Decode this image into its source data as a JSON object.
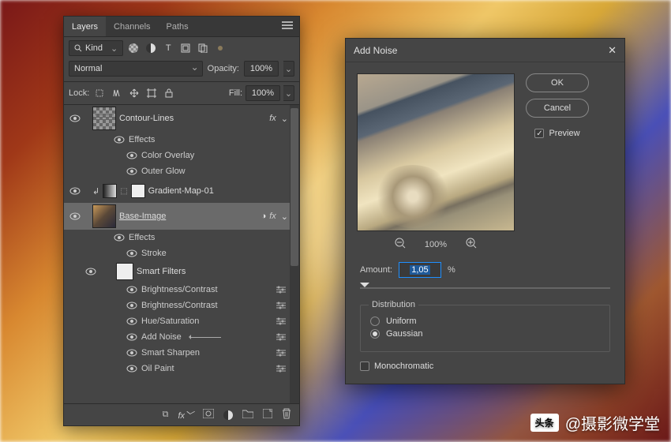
{
  "panel": {
    "tabs": {
      "layers": "Layers",
      "channels": "Channels",
      "paths": "Paths"
    },
    "kind_label": "Kind",
    "blend_mode": "Normal",
    "opacity_label": "Opacity:",
    "opacity_value": "100%",
    "lock_label": "Lock:",
    "fill_label": "Fill:",
    "fill_value": "100%"
  },
  "layers": {
    "contour": "Contour-Lines",
    "effects": "Effects",
    "color_overlay": "Color Overlay",
    "outer_glow": "Outer Glow",
    "gradient_map": "Gradient-Map-01",
    "base_image": "Base-Image",
    "stroke": "Stroke",
    "smart_filters": "Smart Filters",
    "filters": {
      "bc1": "Brightness/Contrast",
      "bc2": "Brightness/Contrast",
      "hue": "Hue/Saturation",
      "noise": "Add Noise",
      "sharpen": "Smart Sharpen",
      "oil": "Oil Paint"
    },
    "fx": "fx"
  },
  "dialog": {
    "title": "Add Noise",
    "ok": "OK",
    "cancel": "Cancel",
    "preview": "Preview",
    "zoom": "100%",
    "amount_label": "Amount:",
    "amount_value": "1,05",
    "amount_suffix": "%",
    "distribution": "Distribution",
    "uniform": "Uniform",
    "gaussian": "Gaussian",
    "mono": "Monochromatic"
  },
  "watermark": {
    "badge": "头条",
    "text": "@摄影微学堂"
  }
}
